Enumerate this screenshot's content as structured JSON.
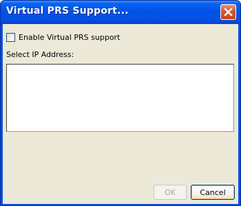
{
  "window": {
    "title": "Virtual PRS Support...",
    "close_icon": "close-icon"
  },
  "options": {
    "enable_label": "Enable Virtual PRS support",
    "enable_checked": false
  },
  "ip": {
    "label": "Select IP Address:",
    "items": []
  },
  "buttons": {
    "ok_label": "OK",
    "ok_enabled": false,
    "cancel_label": "Cancel"
  },
  "colors": {
    "titlebar": "#0053e8",
    "dialog_bg": "#ece9d8",
    "close_button": "#d8592f"
  }
}
